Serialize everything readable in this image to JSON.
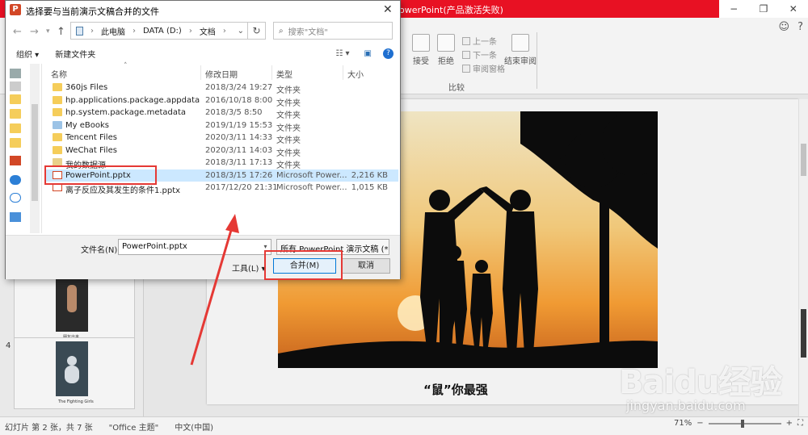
{
  "ppt": {
    "title_fragment": "owerPoint(产品激活失败)",
    "window_controls": [
      "−",
      "❐",
      "✕"
    ],
    "ribbon": {
      "accept": "接受",
      "reject": "拒绝",
      "previous": "上一条",
      "next": "下一条",
      "reviewing_pane": "审阅窗格",
      "end_review": "结束审阅",
      "group_label": "比较"
    },
    "slide_number": "4",
    "slide_caption": "“鼠”你最强",
    "thumb_caption_3": "朋友出来",
    "thumb_caption_4": "The Fighting Girls"
  },
  "statusbar": {
    "slide_info": "幻灯片 第 2 张，共 7 张",
    "theme": "\"Office 主题\"",
    "language": "中文(中国)",
    "zoom": "71%"
  },
  "watermark": {
    "baidu": "Baidu经验",
    "url": "jingyan.baidu.com"
  },
  "dialog": {
    "icon_letter": "P",
    "title": "选择要与当前演示文稿合并的文件",
    "close": "✕",
    "address": {
      "pc": "此电脑",
      "drive": "DATA (D:)",
      "folder": "文档"
    },
    "search_placeholder": "搜索\"文档\"",
    "organize": "组织",
    "new_folder": "新建文件夹",
    "columns": {
      "name": "名称",
      "date": "修改日期",
      "type": "类型",
      "size": "大小"
    },
    "files": [
      {
        "name": "360js Files",
        "date": "2018/3/24 19:27",
        "type": "文件夹",
        "size": "",
        "kind": "folder"
      },
      {
        "name": "hp.applications.package.appdata",
        "date": "2016/10/18 8:00",
        "type": "文件夹",
        "size": "",
        "kind": "folder"
      },
      {
        "name": "hp.system.package.metadata",
        "date": "2018/3/5 8:50",
        "type": "文件夹",
        "size": "",
        "kind": "folder"
      },
      {
        "name": "My eBooks",
        "date": "2019/1/19 15:53",
        "type": "文件夹",
        "size": "",
        "kind": "folder"
      },
      {
        "name": "Tencent Files",
        "date": "2020/3/11 14:33",
        "type": "文件夹",
        "size": "",
        "kind": "folder"
      },
      {
        "name": "WeChat Files",
        "date": "2020/3/11 14:03",
        "type": "文件夹",
        "size": "",
        "kind": "folder"
      },
      {
        "name": "我的数据源",
        "date": "2018/3/11 17:13",
        "type": "文件夹",
        "size": "",
        "kind": "folder"
      },
      {
        "name": "PowerPoint.pptx",
        "date": "2018/3/15 17:26",
        "type": "Microsoft Power...",
        "size": "2,216 KB",
        "kind": "doc"
      },
      {
        "name": "离子反应及其发生的条件1.pptx",
        "date": "2017/12/20 21:31",
        "type": "Microsoft Power...",
        "size": "1,015 KB",
        "kind": "doc"
      }
    ],
    "filename_label": "文件名(N):",
    "filename_value": "PowerPoint.pptx",
    "filetype": "所有 PowerPoint 演示文稿 (*.p",
    "tools": "工具(L)",
    "merge": "合并(M)",
    "cancel": "取消"
  },
  "colors": {
    "ppt_titlebar": "#e81123",
    "annotation_red": "#e53935",
    "selection": "#cce8ff"
  }
}
